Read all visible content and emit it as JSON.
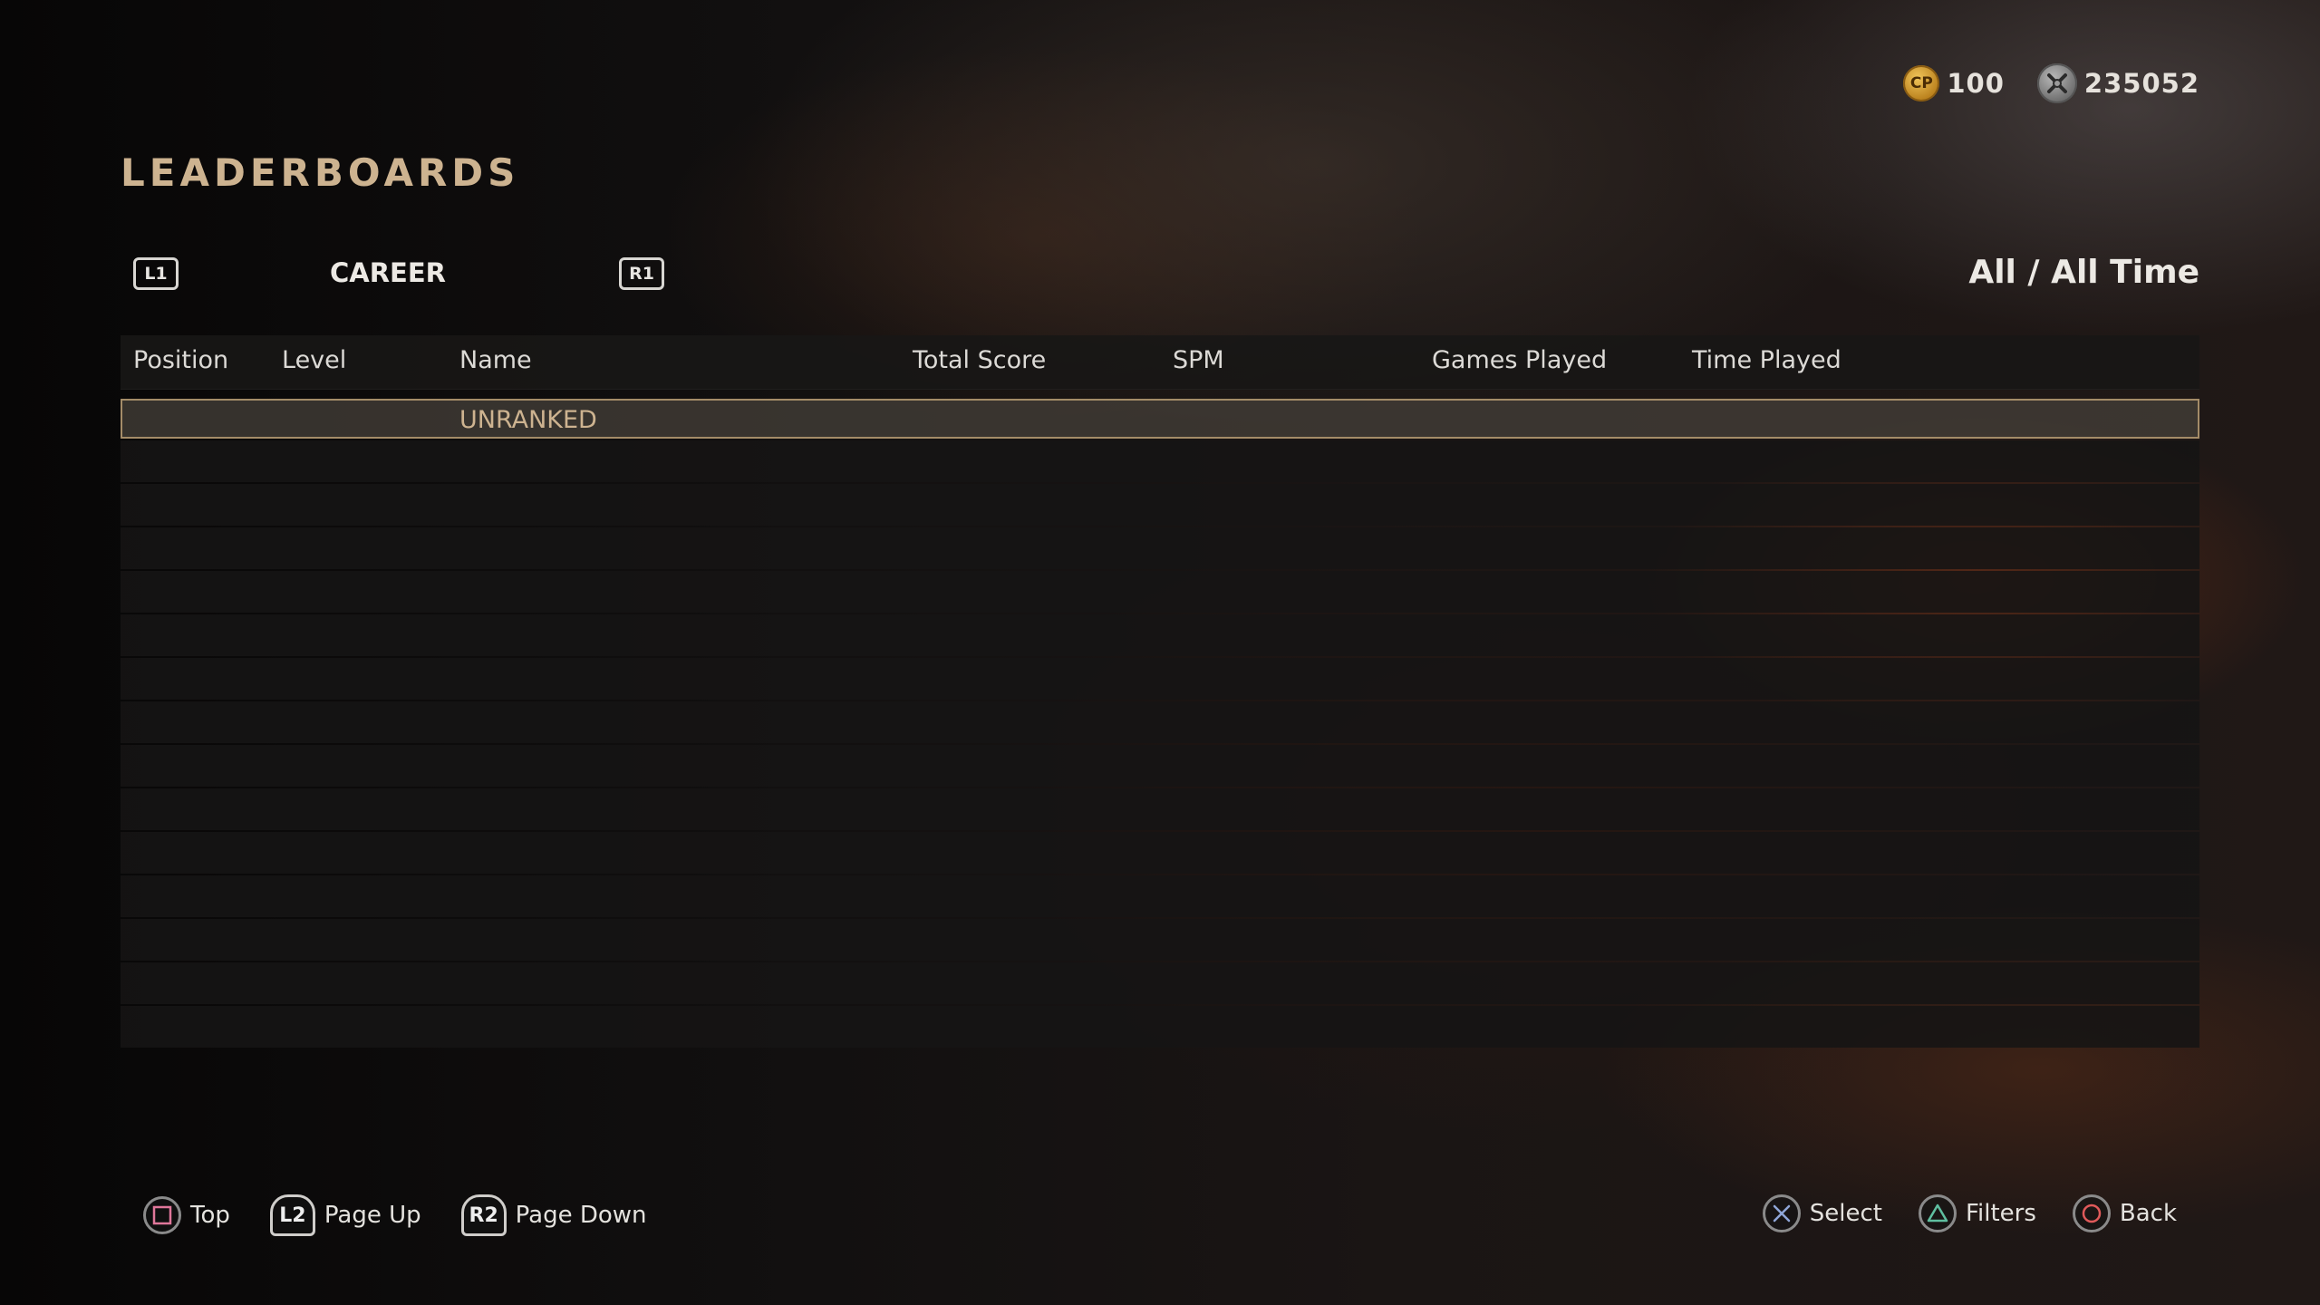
{
  "currency": {
    "cp": {
      "icon": "cod-points-icon",
      "label": "CP",
      "value": "100",
      "color": "#d9a53a"
    },
    "salvage": {
      "icon": "armory-credits-icon",
      "value": "235052"
    }
  },
  "page_title": "LEADERBOARDS",
  "tabbar": {
    "left_bumper": "L1",
    "right_bumper": "R1",
    "active_tab": "CAREER",
    "filter": "All / All Time"
  },
  "table": {
    "columns": [
      "Position",
      "Level",
      "Name",
      "Total Score",
      "SPM",
      "Games Played",
      "Time Played"
    ],
    "rows": [
      {
        "position": "",
        "level": "",
        "name": "UNRANKED",
        "total_score": "",
        "spm": "",
        "games_played": "",
        "time_played": ""
      },
      {
        "position": "",
        "level": "",
        "name": "",
        "total_score": "",
        "spm": "",
        "games_played": "",
        "time_played": ""
      },
      {
        "position": "",
        "level": "",
        "name": "",
        "total_score": "",
        "spm": "",
        "games_played": "",
        "time_played": ""
      },
      {
        "position": "",
        "level": "",
        "name": "",
        "total_score": "",
        "spm": "",
        "games_played": "",
        "time_played": ""
      },
      {
        "position": "",
        "level": "",
        "name": "",
        "total_score": "",
        "spm": "",
        "games_played": "",
        "time_played": ""
      },
      {
        "position": "",
        "level": "",
        "name": "",
        "total_score": "",
        "spm": "",
        "games_played": "",
        "time_played": ""
      },
      {
        "position": "",
        "level": "",
        "name": "",
        "total_score": "",
        "spm": "",
        "games_played": "",
        "time_played": ""
      },
      {
        "position": "",
        "level": "",
        "name": "",
        "total_score": "",
        "spm": "",
        "games_played": "",
        "time_played": ""
      },
      {
        "position": "",
        "level": "",
        "name": "",
        "total_score": "",
        "spm": "",
        "games_played": "",
        "time_played": ""
      },
      {
        "position": "",
        "level": "",
        "name": "",
        "total_score": "",
        "spm": "",
        "games_played": "",
        "time_played": ""
      },
      {
        "position": "",
        "level": "",
        "name": "",
        "total_score": "",
        "spm": "",
        "games_played": "",
        "time_played": ""
      },
      {
        "position": "",
        "level": "",
        "name": "",
        "total_score": "",
        "spm": "",
        "games_played": "",
        "time_played": ""
      },
      {
        "position": "",
        "level": "",
        "name": "",
        "total_score": "",
        "spm": "",
        "games_played": "",
        "time_played": ""
      },
      {
        "position": "",
        "level": "",
        "name": "",
        "total_score": "",
        "spm": "",
        "games_played": "",
        "time_played": ""
      },
      {
        "position": "",
        "level": "",
        "name": "",
        "total_score": "",
        "spm": "",
        "games_played": "",
        "time_played": ""
      }
    ]
  },
  "footer": {
    "left": [
      {
        "icon": "square-button-icon",
        "label": "Top",
        "color": "#e0779a"
      },
      {
        "icon": "l2-trigger-icon",
        "button": "L2",
        "label": "Page Up"
      },
      {
        "icon": "r2-trigger-icon",
        "button": "R2",
        "label": "Page Down"
      }
    ],
    "right": [
      {
        "icon": "cross-button-icon",
        "label": "Select",
        "color": "#8fa6d8"
      },
      {
        "icon": "triangle-button-icon",
        "label": "Filters",
        "color": "#5fbfa0"
      },
      {
        "icon": "circle-button-icon",
        "label": "Back",
        "color": "#e05a5a"
      }
    ]
  },
  "colors": {
    "accent": "#cdb390",
    "selected_border": "#a48c68"
  }
}
